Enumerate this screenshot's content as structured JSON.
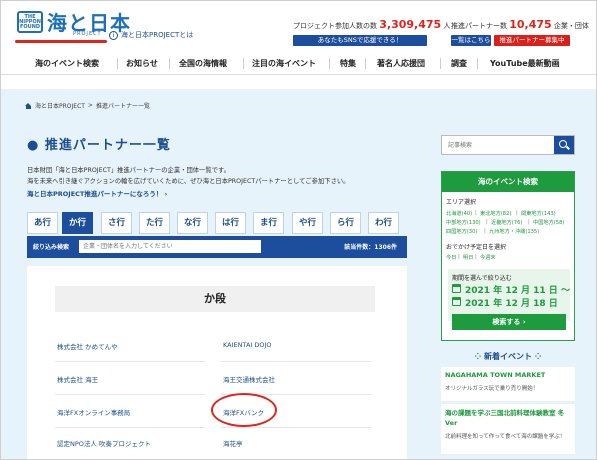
{
  "header": {
    "logo_lines": [
      "THE",
      "NIPPON",
      "FOUND"
    ],
    "logo_text": "海と日本",
    "logo_sub": "PROJECT",
    "about_link": "海と日本PROJECTとは",
    "participants_label": "プロジェクト参加人数の数",
    "participants_count": "3,309,475",
    "participants_unit": "人",
    "partners_label": "推進パートナー数",
    "partners_count": "10,475",
    "partners_unit": "企業・団体",
    "sns_button": "あなたもSNSで応援できる！",
    "list_button": "一覧はこちら",
    "recruit_button": "推進パートナー募集中"
  },
  "nav": [
    "海のイベント検索",
    "お知らせ",
    "全国の海情報",
    "注目の海イベント",
    "特集",
    "著名人応援団",
    "調査",
    "YouTube最新動画"
  ],
  "breadcrumb": [
    "海と日本PROJECT",
    "推進パートナー一覧"
  ],
  "page": {
    "title": "推進パートナー一覧",
    "intro_1": "日本財団「海と日本PROJECT」推進パートナーの企業・団体一覧です。",
    "intro_2": "海を未来へ引き継ぐアクションの輪を広げていくために、ぜひ海と日本PROJECTパートナーとしてご参加下さい。",
    "intro_link": "海と日本PROJECT推進パートナーになろう！"
  },
  "kana_tabs": [
    "あ行",
    "か行",
    "さ行",
    "た行",
    "な行",
    "は行",
    "ま行",
    "や行",
    "ら行",
    "わ行"
  ],
  "active_tab": 1,
  "filter": {
    "label": "絞り込み検索",
    "placeholder": "企業・団体名を入力してください",
    "count": "該当件数：1306件"
  },
  "list": {
    "section": "か段",
    "entries": [
      "株式会社 かめてんや",
      "KAIENTAI DOJO",
      "株式会社 海王",
      "海王交通株式会社",
      "海洋FXオンライン事務局",
      "海洋FXバンク",
      "認定NPO法人 吹奏プロジェクト",
      "海花亭"
    ]
  },
  "sidebar": {
    "search_placeholder": "記事検索",
    "event_search": {
      "title": "海のイベント検索",
      "area_label": "エリア選択",
      "areas": [
        "北海道(40)",
        "東北地方(82)",
        "関東地方(143)",
        "中部地方(130)",
        "近畿地方(76)",
        "中国地方(58)",
        "四国地方(30)",
        "九州地方・沖縄(135)"
      ],
      "date_label": "おでかけ予定日を選択",
      "dates": [
        "今日",
        "明日",
        "今週末"
      ],
      "period_label": "期間を選んで絞り込む",
      "from_prefix": "2021 年",
      "from_month": "12",
      "from_day": "11",
      "to_prefix": "2021 年",
      "to_month": "12",
      "to_day": "18",
      "search_button": "検索する"
    },
    "new_events_title": "新着イベント",
    "news": [
      {
        "title": "NAGAHAMA TOWN MARKET",
        "text": "オリジナルガラス玩で乗り売り開始！"
      },
      {
        "title": "海の課題を学ぶ三国北前料理体験教室 冬Ver",
        "text": "北前料理を知って作って食べて海の課題を学ぶ！"
      }
    ]
  }
}
